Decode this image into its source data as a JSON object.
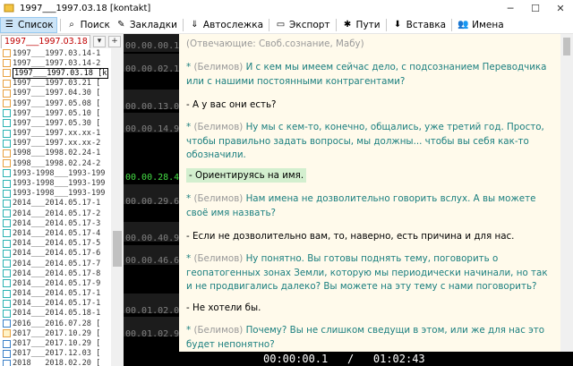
{
  "window": {
    "title": "1997___1997.03.18 [kontakt]",
    "controls": {
      "minimize": "─",
      "maximize": "☐",
      "close": "✕"
    }
  },
  "toolbar": [
    {
      "label": "Список",
      "icon": "list-icon",
      "glyph": "☰",
      "active": true
    },
    {
      "label": "Поиск",
      "icon": "search-icon",
      "glyph": "⌕"
    },
    {
      "label": "Закладки",
      "icon": "bookmark-icon",
      "glyph": "✎"
    },
    {
      "label": "Автослежка",
      "icon": "autotrack-icon",
      "glyph": "⇓"
    },
    {
      "label": "Экспорт",
      "icon": "export-icon",
      "glyph": "▭"
    },
    {
      "label": "Пути",
      "icon": "paths-icon",
      "glyph": "✱"
    },
    {
      "label": "Вставка",
      "icon": "insert-icon",
      "glyph": "⬇"
    },
    {
      "label": "Имена",
      "icon": "names-icon",
      "glyph": "👥"
    }
  ],
  "file_tab": {
    "label": "1997___1997.03.18 [kont",
    "dropdown": "▾",
    "add": "+"
  },
  "file_list": [
    {
      "name": "1997___1997.03.14-1",
      "kind": "orange"
    },
    {
      "name": "1997___1997.03.14-2",
      "kind": "orange"
    },
    {
      "name": "1997___1997.03.18 [k",
      "kind": "orange",
      "selected": true
    },
    {
      "name": "1997___1997.03.21 [",
      "kind": "orange"
    },
    {
      "name": "1997___1997.04.30 [",
      "kind": "orange"
    },
    {
      "name": "1997___1997.05.08 [",
      "kind": "orange"
    },
    {
      "name": "1997___1997.05.10 [",
      "kind": "teal"
    },
    {
      "name": "1997___1997.05.30 [",
      "kind": "teal"
    },
    {
      "name": "1997___1997.xx.xx-1",
      "kind": "teal"
    },
    {
      "name": "1997___1997.xx.xx-2",
      "kind": "teal"
    },
    {
      "name": "1998___1998.02.24-1",
      "kind": "orange"
    },
    {
      "name": "1998___1998.02.24-2",
      "kind": "orange"
    },
    {
      "name": "1993-1998___1993-199",
      "kind": "teal"
    },
    {
      "name": "1993-1998___1993-199",
      "kind": "teal"
    },
    {
      "name": "1993-1998___1993-199",
      "kind": "teal"
    },
    {
      "name": "2014___2014.05.17-1",
      "kind": "teal"
    },
    {
      "name": "2014___2014.05.17-2",
      "kind": "teal"
    },
    {
      "name": "2014___2014.05.17-3",
      "kind": "teal"
    },
    {
      "name": "2014___2014.05.17-4",
      "kind": "teal"
    },
    {
      "name": "2014___2014.05.17-5",
      "kind": "teal"
    },
    {
      "name": "2014___2014.05.17-6",
      "kind": "teal"
    },
    {
      "name": "2014___2014.05.17-7",
      "kind": "teal"
    },
    {
      "name": "2014___2014.05.17-8",
      "kind": "teal"
    },
    {
      "name": "2014___2014.05.17-9",
      "kind": "teal"
    },
    {
      "name": "2014___2014.05.17-1",
      "kind": "teal"
    },
    {
      "name": "2014___2014.05.17-1",
      "kind": "teal"
    },
    {
      "name": "2014___2014.05.18-1",
      "kind": "teal"
    },
    {
      "name": "2016___2016.07.28 [",
      "kind": "flag"
    },
    {
      "name": "2017___2017.10.29 [",
      "kind": "note"
    },
    {
      "name": "2017___2017.10.29 [",
      "kind": "flag"
    },
    {
      "name": "2017___2017.12.03 [",
      "kind": "flag"
    },
    {
      "name": "2018___2018.02.20 [",
      "kind": "flag"
    },
    {
      "name": "2018___2018.02.20 [",
      "kind": "flag"
    }
  ],
  "timeline": [
    {
      "time": "00.00.00.1",
      "current": false
    },
    {
      "time": "00.00.02.1",
      "current": false
    },
    {
      "time": "00.00.13.0",
      "current": false
    },
    {
      "time": "00.00.14.9",
      "current": false
    },
    {
      "time": "00.00.28.4",
      "current": true
    },
    {
      "time": "00.00.29.6",
      "current": false
    },
    {
      "time": "00.00.40.9",
      "current": false
    },
    {
      "time": "00.00.46.6",
      "current": false
    },
    {
      "time": "00.01.02.0",
      "current": false
    },
    {
      "time": "00.01.02.9",
      "current": false
    }
  ],
  "transcript": [
    {
      "text": "(Отвечающие: Своб.сознание, Мабу)",
      "style": "grey"
    },
    {
      "marker": "*",
      "speaker": "(Белимов)",
      "text": "И с кем мы имеем сейчас дело, с подсознанием Переводчика или с нашими постоянными контрагентами?",
      "style": "teal"
    },
    {
      "text": "- А у вас они есть?",
      "style": "black"
    },
    {
      "marker": "*",
      "speaker": "(Белимов)",
      "text": "Ну мы с кем-то, конечно, общались, уже третий год. Просто, чтобы правильно задать вопросы, мы должны... чтобы вы себя как-то обозначили.",
      "style": "teal"
    },
    {
      "text": "- Ориентируясь на имя.",
      "style": "black",
      "highlight": true
    },
    {
      "marker": "*",
      "speaker": "(Белимов)",
      "text": "Нам имена не дозволительно говорить вслух. А вы можете своё имя назвать?",
      "style": "teal"
    },
    {
      "text": "- Если не дозволительно вам, то, наверно, есть причина и для нас.",
      "style": "black"
    },
    {
      "marker": "*",
      "speaker": "(Белимов)",
      "text": "Ну понятно. Вы готовы поднять тему, поговорить о геопатогенных зонах Земли, которую мы периодически начинали, но так и не продвигались далеко? Вы можете на эту тему с нами поговорить?",
      "style": "teal"
    },
    {
      "text": "- Не хотели бы.",
      "style": "black"
    },
    {
      "marker": "*",
      "speaker": "(Белимов)",
      "text": "Почему? Вы не слишком сведущи в этом, или же для нас это будет непонятно?",
      "style": "teal"
    }
  ],
  "timebar": {
    "current": "00:00:00.1",
    "separator": "/",
    "total": "01:02:43"
  }
}
